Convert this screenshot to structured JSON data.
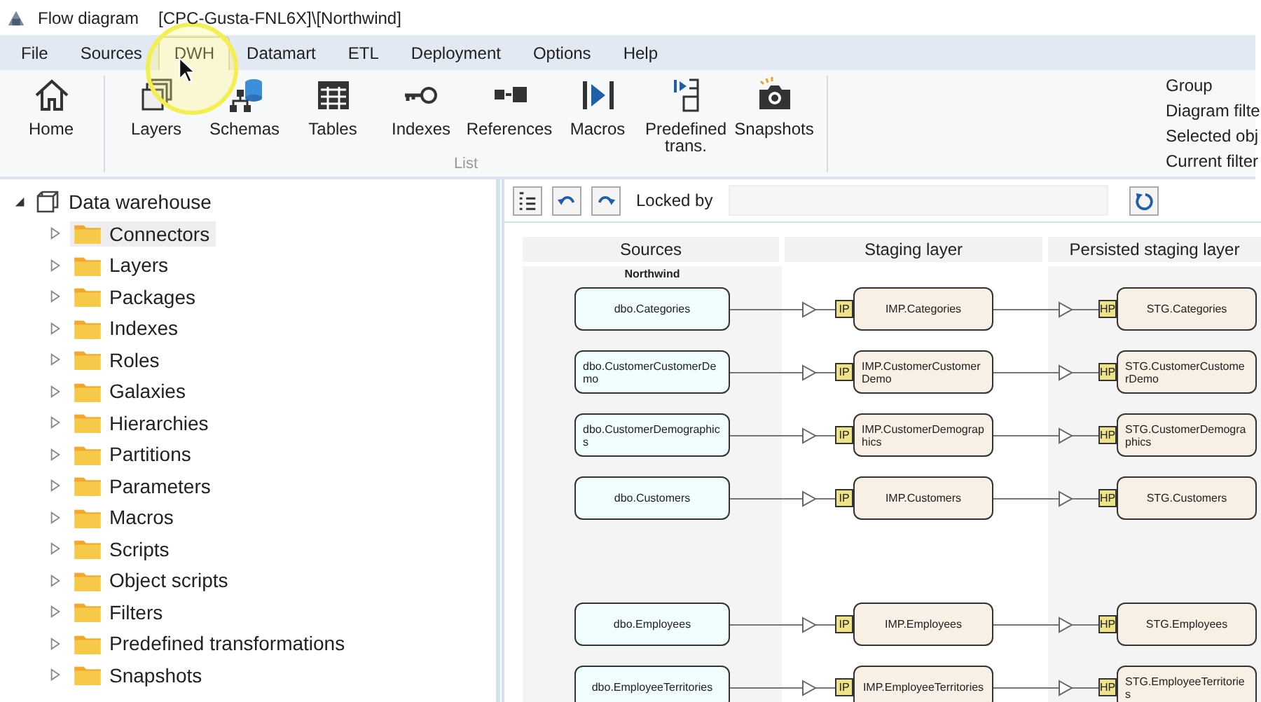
{
  "window": {
    "title": "Flow diagram",
    "path": "[CPC-Gusta-FNL6X]\\[Northwind]"
  },
  "menu_tabs": [
    {
      "label": "File",
      "selected": false
    },
    {
      "label": "Sources",
      "selected": false
    },
    {
      "label": "DWH",
      "selected": true
    },
    {
      "label": "Datamart",
      "selected": false
    },
    {
      "label": "ETL",
      "selected": false
    },
    {
      "label": "Deployment",
      "selected": false
    },
    {
      "label": "Options",
      "selected": false
    },
    {
      "label": "Help",
      "selected": false
    }
  ],
  "ribbon": {
    "groups": [
      {
        "buttons": [
          {
            "label": "Home",
            "kind": "home"
          }
        ]
      },
      {
        "label": "List",
        "buttons": [
          {
            "label": "Layers",
            "kind": "layers"
          },
          {
            "label": "Schemas",
            "kind": "schemas"
          },
          {
            "label": "Tables",
            "kind": "tables"
          },
          {
            "label": "Indexes",
            "kind": "indexes"
          },
          {
            "label": "References",
            "kind": "references"
          },
          {
            "label": "Macros",
            "kind": "macros"
          },
          {
            "label": "Predefined trans.",
            "kind": "transformations"
          },
          {
            "label": "Snapshots",
            "kind": "snapshots"
          }
        ]
      }
    ],
    "side_items": [
      "Group",
      "Diagram filte",
      "Selected obj",
      "Current filter"
    ]
  },
  "tree": {
    "label": "Data warehouse",
    "expanded": true,
    "children": [
      {
        "label": "Connectors",
        "selected": true,
        "expanded": false
      },
      {
        "label": "Layers",
        "selected": false,
        "expanded": false
      },
      {
        "label": "Packages",
        "selected": false,
        "expanded": false
      },
      {
        "label": "Indexes",
        "selected": false,
        "expanded": false
      },
      {
        "label": "Roles",
        "selected": false,
        "expanded": false
      },
      {
        "label": "Galaxies",
        "selected": false,
        "expanded": false
      },
      {
        "label": "Hierarchies",
        "selected": false,
        "expanded": false
      },
      {
        "label": "Partitions",
        "selected": false,
        "expanded": false
      },
      {
        "label": "Parameters",
        "selected": false,
        "expanded": false
      },
      {
        "label": "Macros",
        "selected": false,
        "expanded": false
      },
      {
        "label": "Scripts",
        "selected": false,
        "expanded": false
      },
      {
        "label": "Object scripts",
        "selected": false,
        "expanded": false
      },
      {
        "label": "Filters",
        "selected": false,
        "expanded": false
      },
      {
        "label": "Predefined transformations",
        "selected": false,
        "expanded": false
      },
      {
        "label": "Snapshots",
        "selected": false,
        "expanded": false
      }
    ]
  },
  "toolbar": {
    "locked_by_label": "Locked by"
  },
  "diagram": {
    "columns": [
      "Sources",
      "Staging layer",
      "Persisted staging layer"
    ],
    "source_group": "Northwind",
    "rows": [
      {
        "kind": "flow",
        "source": "dbo.Categories",
        "staging_badge": "IP",
        "staging": "IMP.Categories",
        "persisted_badge": "HP",
        "persisted": "STG.Categories"
      },
      {
        "kind": "flow",
        "source": "dbo.CustomerCustomerDemo",
        "staging_badge": "IP",
        "staging": "IMP.CustomerCustomerDemo",
        "persisted_badge": "HP",
        "persisted": "STG.CustomerCustomerDemo"
      },
      {
        "kind": "flow",
        "source": "dbo.CustomerDemographics",
        "staging_badge": "IP",
        "staging": "IMP.CustomerDemographics",
        "persisted_badge": "HP",
        "persisted": "STG.CustomerDemographics"
      },
      {
        "kind": "flow",
        "source": "dbo.Customers",
        "staging_badge": "IP",
        "staging": "IMP.Customers",
        "persisted_badge": "HP",
        "persisted": "STG.Customers"
      },
      {
        "kind": "blank"
      },
      {
        "kind": "flow",
        "source": "dbo.Employees",
        "staging_badge": "IP",
        "staging": "IMP.Employees",
        "persisted_badge": "HP",
        "persisted": "STG.Employees"
      },
      {
        "kind": "flow",
        "source": "dbo.EmployeeTerritories",
        "staging_badge": "IP",
        "staging": "IMP.EmployeeTerritories",
        "persisted_badge": "HP",
        "persisted": "STG.EmployeeTerritories"
      }
    ]
  }
}
